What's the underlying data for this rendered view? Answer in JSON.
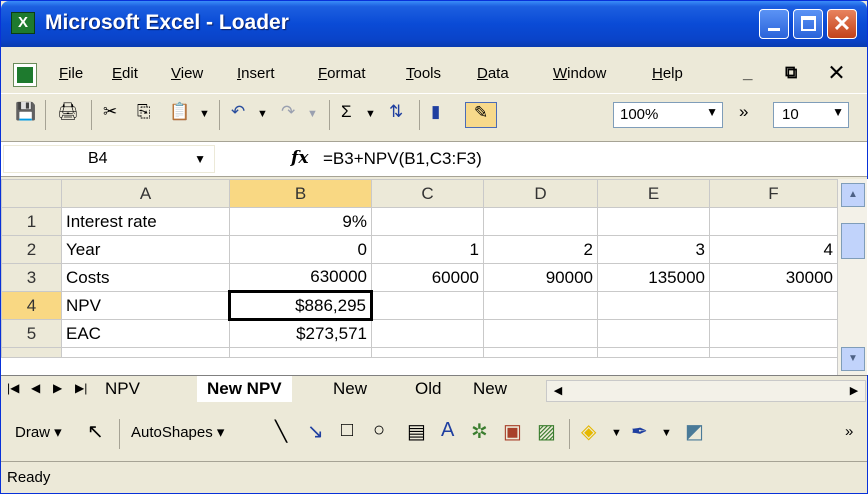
{
  "window": {
    "title": "Microsoft Excel - Loader",
    "app_icon": "X"
  },
  "menu": {
    "items": [
      "File",
      "Edit",
      "View",
      "Insert",
      "Format",
      "Tools",
      "Data",
      "Window",
      "Help"
    ],
    "controls": "_ ⧉ ✕"
  },
  "toolbar": {
    "zoom": "100%",
    "font_size": "10",
    "overflow": "»"
  },
  "formula_bar": {
    "cell_ref": "B4",
    "fx": "fx",
    "formula": "=B3+NPV(B1,C3:F3)"
  },
  "grid": {
    "columns": [
      "A",
      "B",
      "C",
      "D",
      "E",
      "F"
    ],
    "selected_column": "B",
    "selected_cell": "B4",
    "rows": [
      {
        "num": "1",
        "cells": [
          "Interest rate",
          "9%",
          "",
          "",
          "",
          ""
        ]
      },
      {
        "num": "2",
        "cells": [
          "Year",
          "0",
          "1",
          "2",
          "3",
          "4"
        ]
      },
      {
        "num": "3",
        "cells": [
          "Costs",
          "630000",
          "60000",
          "90000",
          "135000",
          "30000"
        ]
      },
      {
        "num": "4",
        "cells": [
          "NPV",
          "$886,295",
          "",
          "",
          "",
          ""
        ]
      },
      {
        "num": "5",
        "cells": [
          "EAC",
          "$273,571",
          "",
          "",
          "",
          ""
        ]
      }
    ]
  },
  "sheet_tabs": {
    "items": [
      {
        "label": "NPV",
        "active": false
      },
      {
        "label": "New NPV",
        "active": true
      },
      {
        "label": "New",
        "active": false
      },
      {
        "label": "Old",
        "active": false
      },
      {
        "label": "New",
        "active": false
      }
    ]
  },
  "draw_toolbar": {
    "draw_label": "Draw",
    "autoshapes_label": "AutoShapes"
  },
  "status": {
    "text": "Ready"
  }
}
